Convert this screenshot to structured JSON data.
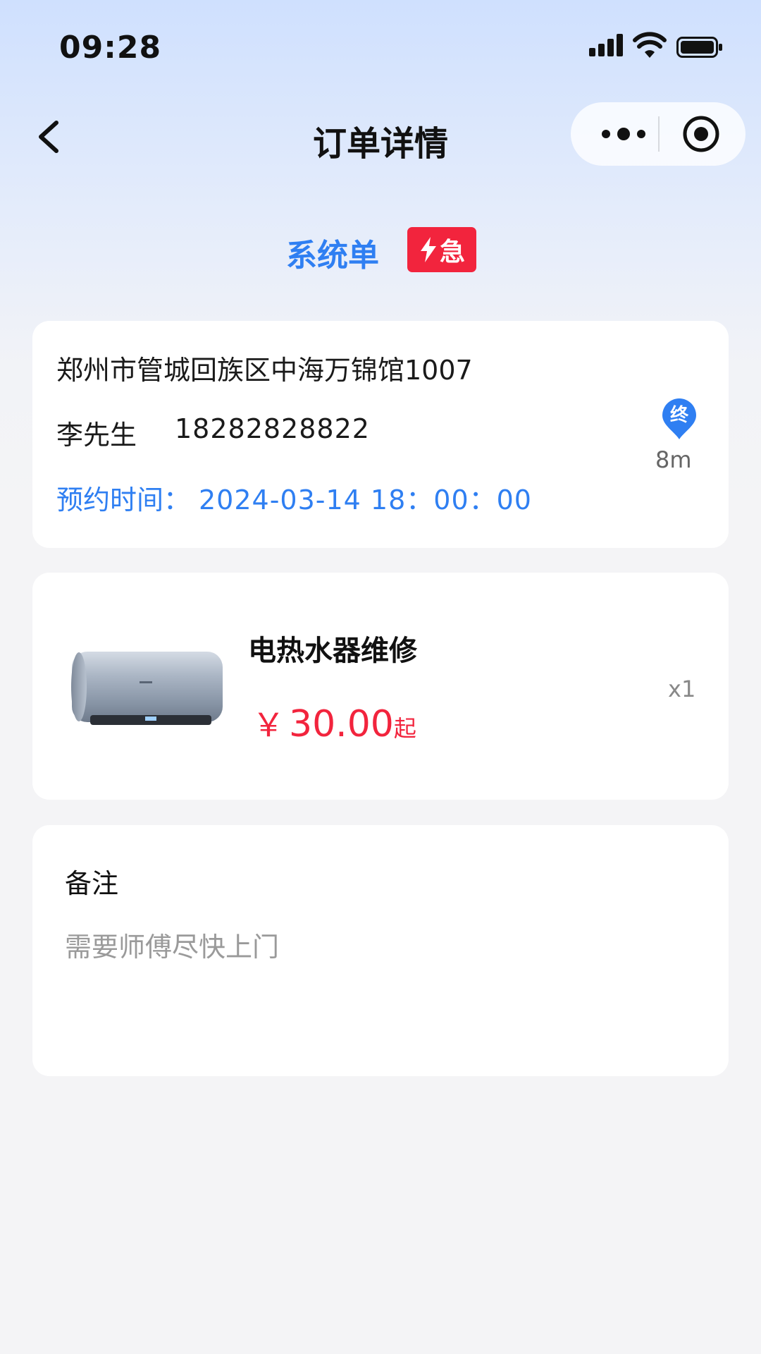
{
  "status_bar": {
    "time": "09:28"
  },
  "nav": {
    "title": "订单详情"
  },
  "order": {
    "type_label": "系统单",
    "urgent_label": "急",
    "address": "郑州市管城回族区中海万锦馆1007",
    "customer_name": "李先生",
    "customer_phone": "18282828822",
    "appointment_label": "预约时间：",
    "appointment_value": "2024-03-14  18：00：00",
    "destination_marker": "终",
    "distance": "8m"
  },
  "service": {
    "name": "电热水器维修",
    "currency": "￥",
    "price": "30.00",
    "price_suffix": "起",
    "quantity": "x1"
  },
  "remark": {
    "title": "备注",
    "text": "需要师傅尽快上门"
  },
  "colors": {
    "accent_blue": "#2f7ff2",
    "urgent_red": "#f2243d",
    "price_red": "#f2243d"
  }
}
